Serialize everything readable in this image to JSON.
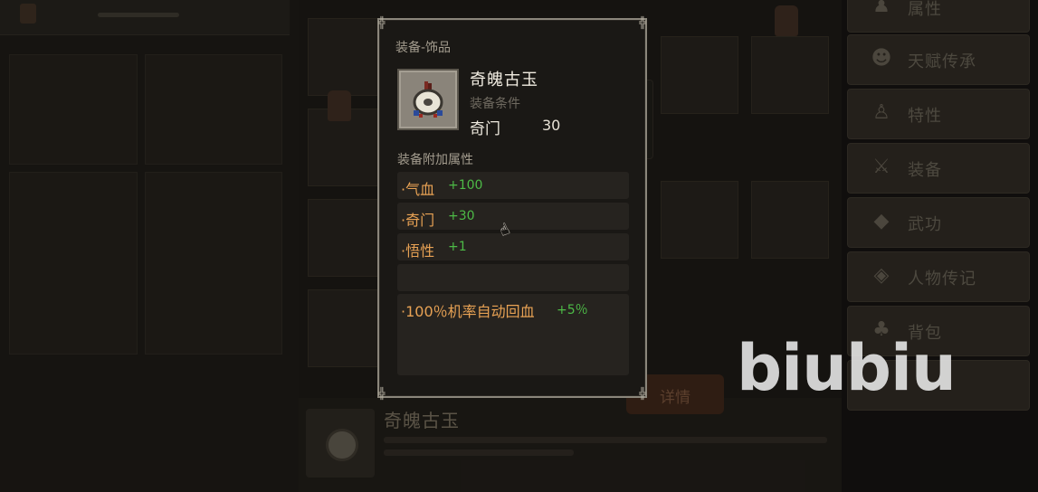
{
  "background": {
    "bottom_item_title": "奇魄古玉",
    "detail_button": "详情",
    "menu": [
      {
        "icon": "person-icon",
        "label": "属性"
      },
      {
        "icon": "talent-icon",
        "label": "天赋传承"
      },
      {
        "icon": "trait-icon",
        "label": "特性"
      },
      {
        "icon": "sword-icon",
        "label": "装备"
      },
      {
        "icon": "scroll-icon",
        "label": "武功"
      },
      {
        "icon": "diary-icon",
        "label": "人物传记"
      },
      {
        "icon": "bag-icon",
        "label": "背包"
      },
      {
        "icon": "more-icon",
        "label": ""
      }
    ]
  },
  "tooltip": {
    "category": "装备-饰品",
    "item_name": "奇魄古玉",
    "requirement_label": "装备条件",
    "requirement_stat": "奇门",
    "requirement_value": "30",
    "attributes_header": "装备附加属性",
    "attributes": [
      {
        "name": "·气血",
        "value": "+100"
      },
      {
        "name": "·奇门",
        "value": "+30"
      },
      {
        "name": "·悟性",
        "value": "+1"
      },
      {
        "name": "",
        "value": ""
      }
    ],
    "special": {
      "name": "·100％机率自动回血",
      "value": "+5％"
    }
  },
  "watermark": "biubiu",
  "colors": {
    "attribute_name": "#e8a254",
    "attribute_value": "#4dbb47",
    "panel_border": "#8b867b",
    "panel_bg": "#1a1815"
  }
}
